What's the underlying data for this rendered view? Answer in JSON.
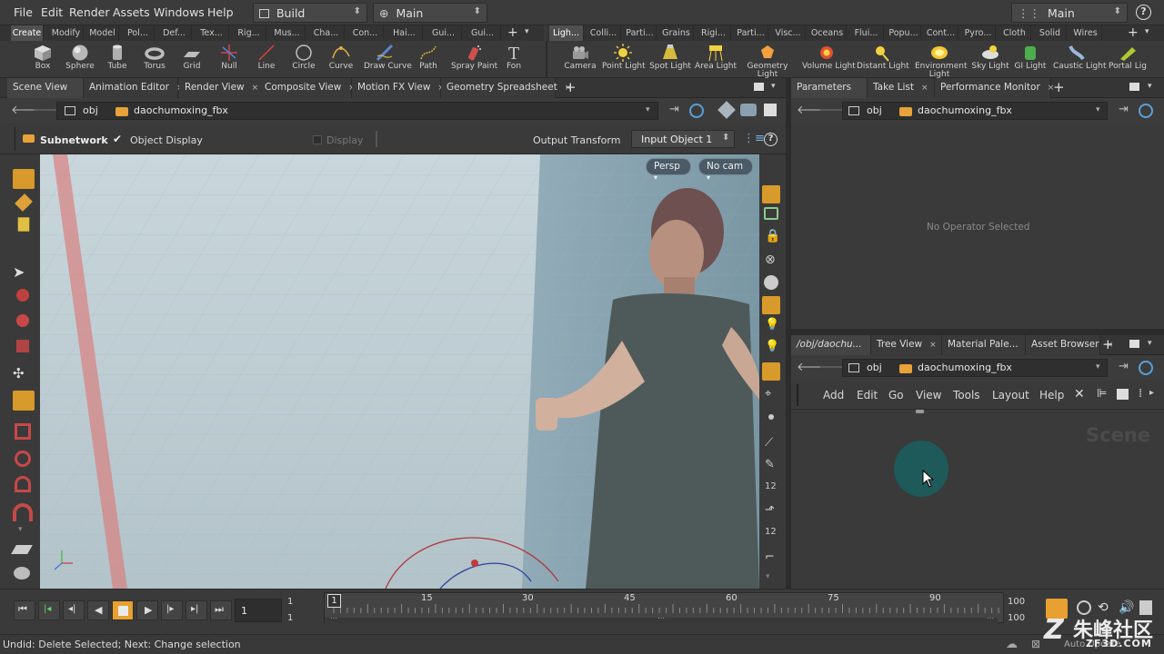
{
  "menubar": {
    "items": [
      "File",
      "Edit",
      "Render",
      "Assets",
      "Windows",
      "Help"
    ],
    "desktop": "Build",
    "context": "Main",
    "desktop_right": "Main",
    "help_icon": "question-icon"
  },
  "shelf": {
    "left_tabs": [
      "Create",
      "Modify",
      "Model",
      "Pol...",
      "Def...",
      "Tex...",
      "Rig...",
      "Mus...",
      "Cha...",
      "Con...",
      "Hai...",
      "Gui...",
      "Gui..."
    ],
    "right_tabs": [
      "Ligh...",
      "Colli...",
      "Parti...",
      "Grains",
      "Rigi...",
      "Parti...",
      "Visc...",
      "Oceans",
      "Flui...",
      "Popu...",
      "Cont...",
      "Pyro...",
      "Cloth",
      "Solid",
      "Wires"
    ],
    "left_tools": [
      "Box",
      "Sphere",
      "Tube",
      "Torus",
      "Grid",
      "Null",
      "Line",
      "Circle",
      "Curve",
      "Draw Curve",
      "Path",
      "Spray Paint",
      "Fon"
    ],
    "right_tools": [
      "Camera",
      "Point Light",
      "Spot Light",
      "Area Light",
      "Geometry Light",
      "Volume Light",
      "Distant Light",
      "Environment Light",
      "Sky Light",
      "GI Light",
      "Caustic Light",
      "Portal Lig"
    ]
  },
  "scene_pane": {
    "tabs": [
      "Scene View",
      "Animation Editor",
      "Render View",
      "Composite View",
      "Motion FX View",
      "Geometry Spreadsheet"
    ],
    "path_root": "obj",
    "path_node": "daochumoxing_fbx",
    "op_bar": {
      "subnetwork": "Subnetwork",
      "object_display": "Object Display",
      "display": "Display",
      "output_transform": "Output Transform",
      "input_object": "Input Object 1"
    },
    "persp_btn": "Persp",
    "cam_btn": "No cam"
  },
  "params_pane": {
    "tabs": [
      "Parameters",
      "Take List",
      "Performance Monitor"
    ],
    "path_root": "obj",
    "path_node": "daochumoxing_fbx",
    "empty_msg": "No Operator Selected"
  },
  "network_pane": {
    "tabs": [
      "/obj/daochu...",
      "Tree View",
      "Material Pale...",
      "Asset Browser"
    ],
    "path_root": "obj",
    "path_node": "daochumoxing_fbx",
    "menu": [
      "Add",
      "Edit",
      "Go",
      "View",
      "Tools",
      "Layout",
      "Help"
    ],
    "watermark": "Scene"
  },
  "timeline": {
    "current_frame": "1",
    "start_a": "1",
    "start_b": "1",
    "ticks": [
      "1",
      "15",
      "30",
      "45",
      "60",
      "75",
      "90"
    ],
    "end_a": "100",
    "end_b": "100",
    "mode": "Auto Update"
  },
  "status": {
    "text": "Undid: Delete Selected; Next: Change selection"
  },
  "watermark_logo": "朱峰社区",
  "watermark_url": "ZF3D.COM",
  "colors": {
    "accent": "#f0a020",
    "viewport_bg": "#b7cbd2",
    "network_bg": "#3a3a3a"
  }
}
